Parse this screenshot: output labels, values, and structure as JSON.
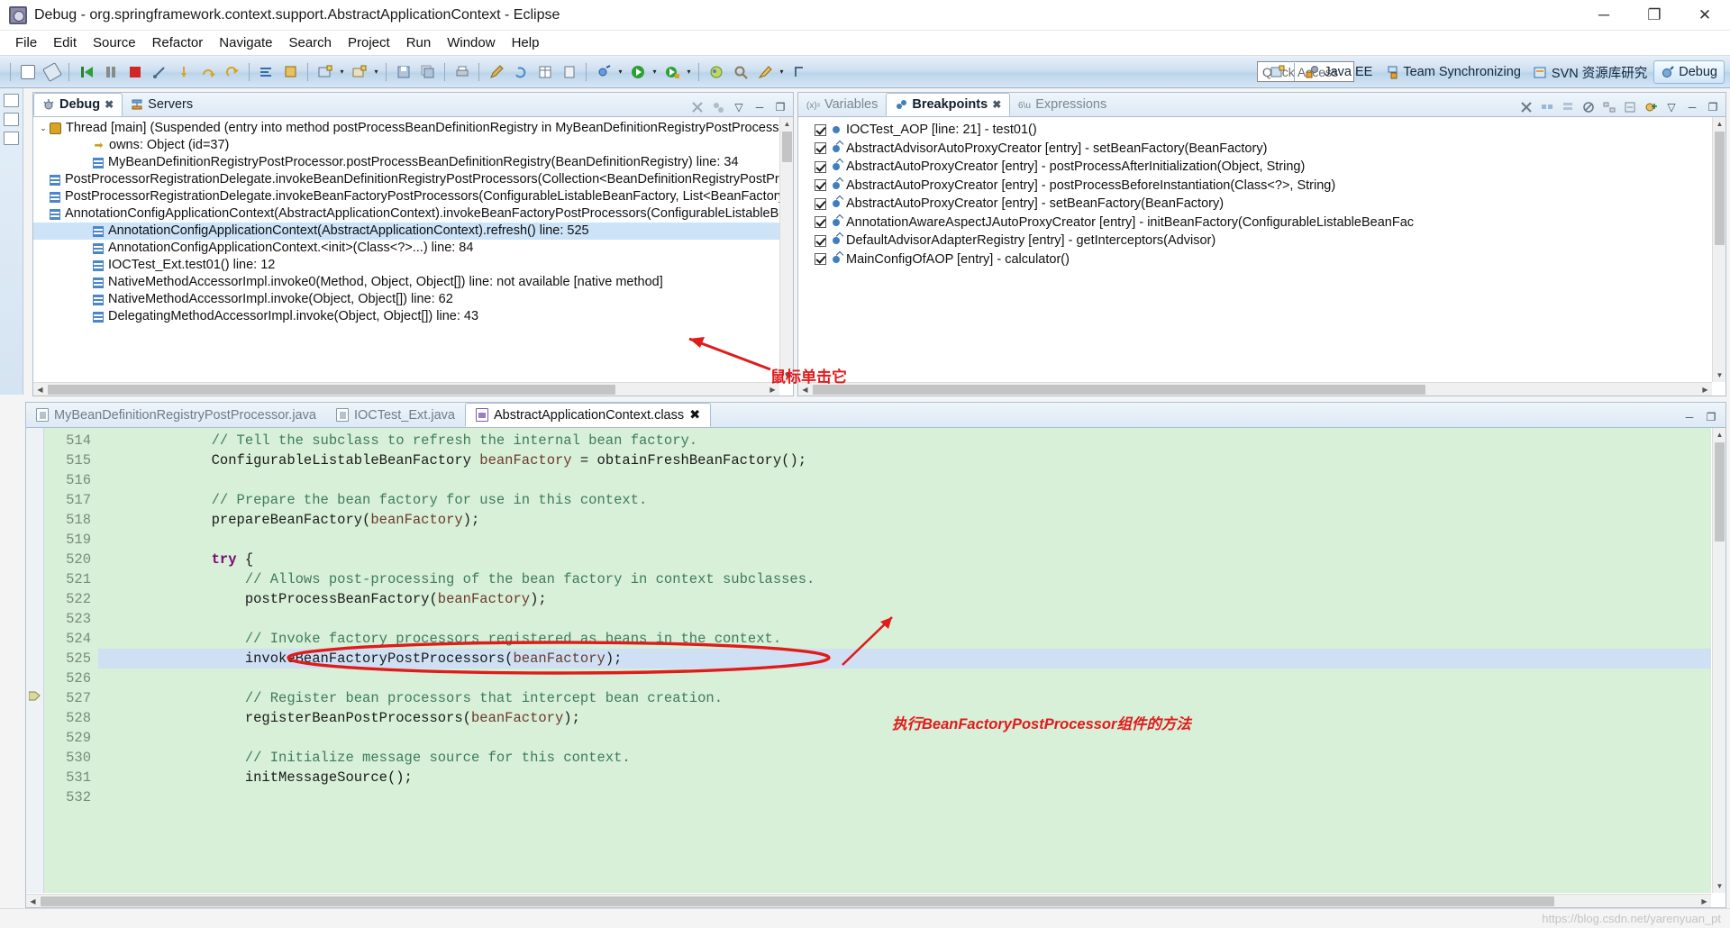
{
  "window": {
    "title": "Debug - org.springframework.context.support.AbstractApplicationContext - Eclipse",
    "app_icon": "eclipse-icon",
    "minimize": "─",
    "maximize": "❐",
    "close": "✕"
  },
  "menubar": [
    "File",
    "Edit",
    "Source",
    "Refactor",
    "Navigate",
    "Search",
    "Project",
    "Run",
    "Window",
    "Help"
  ],
  "toolbar": {
    "quick_access_placeholder": "Quick Access",
    "perspectives": [
      {
        "label": "Java EE",
        "icon": "java-ee-perspective-icon",
        "active": false
      },
      {
        "label": "Team Synchronizing",
        "icon": "team-sync-perspective-icon",
        "active": false
      },
      {
        "label": "SVN 资源库研究",
        "icon": "svn-perspective-icon",
        "active": false
      },
      {
        "label": "Debug",
        "icon": "debug-perspective-icon",
        "active": true
      }
    ]
  },
  "debug_view": {
    "tabs": [
      {
        "label": "Debug",
        "icon": "debug-icon",
        "active": true,
        "close": "✖"
      },
      {
        "label": "Servers",
        "icon": "servers-icon",
        "active": false
      }
    ],
    "tree": [
      {
        "indent": 0,
        "arrow": "⌄",
        "icon": "thread-icon",
        "text": "Thread [main] (Suspended (entry into method postProcessBeanDefinitionRegistry in MyBeanDefinitionRegistryPostProcessor))",
        "selected": false
      },
      {
        "indent": 1,
        "arrow": "",
        "icon": "owns-monitor-icon",
        "text": "owns: Object  (id=37)",
        "selected": false
      },
      {
        "indent": 1,
        "arrow": "",
        "icon": "stack-frame-icon",
        "text": "MyBeanDefinitionRegistryPostProcessor.postProcessBeanDefinitionRegistry(BeanDefinitionRegistry) line: 34",
        "selected": false
      },
      {
        "indent": 1,
        "arrow": "",
        "icon": "stack-frame-icon",
        "text": "PostProcessorRegistrationDelegate.invokeBeanDefinitionRegistryPostProcessors(Collection<BeanDefinitionRegistryPostProce",
        "selected": false
      },
      {
        "indent": 1,
        "arrow": "",
        "icon": "stack-frame-icon",
        "text": "PostProcessorRegistrationDelegate.invokeBeanFactoryPostProcessors(ConfigurableListableBeanFactory, List<BeanFactoryPos",
        "selected": false
      },
      {
        "indent": 1,
        "arrow": "",
        "icon": "stack-frame-icon",
        "text": "AnnotationConfigApplicationContext(AbstractApplicationContext).invokeBeanFactoryPostProcessors(ConfigurableListableBea",
        "selected": false
      },
      {
        "indent": 1,
        "arrow": "",
        "icon": "stack-frame-icon",
        "text": "AnnotationConfigApplicationContext(AbstractApplicationContext).refresh() line: 525",
        "selected": true
      },
      {
        "indent": 1,
        "arrow": "",
        "icon": "stack-frame-icon",
        "text": "AnnotationConfigApplicationContext.<init>(Class<?>...) line: 84",
        "selected": false
      },
      {
        "indent": 1,
        "arrow": "",
        "icon": "stack-frame-icon",
        "text": "IOCTest_Ext.test01() line: 12",
        "selected": false
      },
      {
        "indent": 1,
        "arrow": "",
        "icon": "stack-frame-icon",
        "text": "NativeMethodAccessorImpl.invoke0(Method, Object, Object[]) line: not available [native method]",
        "selected": false
      },
      {
        "indent": 1,
        "arrow": "",
        "icon": "stack-frame-icon",
        "text": "NativeMethodAccessorImpl.invoke(Object, Object[]) line: 62",
        "selected": false
      },
      {
        "indent": 1,
        "arrow": "",
        "icon": "stack-frame-icon",
        "text": "DelegatingMethodAccessorImpl.invoke(Object, Object[]) line: 43",
        "selected": false
      }
    ]
  },
  "breakpoints_view": {
    "tabs": [
      {
        "label": "Variables",
        "icon": "variables-icon",
        "active": false
      },
      {
        "label": "Breakpoints",
        "icon": "breakpoints-icon",
        "active": true,
        "close": "✖"
      },
      {
        "label": "Expressions",
        "icon": "expressions-icon",
        "active": false
      }
    ],
    "items": [
      {
        "checked": true,
        "type": "line",
        "text": "IOCTest_AOP [line: 21] - test01()"
      },
      {
        "checked": true,
        "type": "entry",
        "text": "AbstractAdvisorAutoProxyCreator [entry] - setBeanFactory(BeanFactory)"
      },
      {
        "checked": true,
        "type": "entry",
        "text": "AbstractAutoProxyCreator [entry] - postProcessAfterInitialization(Object, String)"
      },
      {
        "checked": true,
        "type": "entry",
        "text": "AbstractAutoProxyCreator [entry] - postProcessBeforeInstantiation(Class<?>, String)"
      },
      {
        "checked": true,
        "type": "entry",
        "text": "AbstractAutoProxyCreator [entry] - setBeanFactory(BeanFactory)"
      },
      {
        "checked": true,
        "type": "entry",
        "text": "AnnotationAwareAspectJAutoProxyCreator [entry] - initBeanFactory(ConfigurableListableBeanFac"
      },
      {
        "checked": true,
        "type": "entry",
        "text": "DefaultAdvisorAdapterRegistry [entry] - getInterceptors(Advisor)"
      },
      {
        "checked": true,
        "type": "entry",
        "text": "MainConfigOfAOP [entry] - calculator()"
      }
    ]
  },
  "editor": {
    "tabs": [
      {
        "label": "MyBeanDefinitionRegistryPostProcessor.java",
        "icon": "java-file-icon",
        "active": false
      },
      {
        "label": "IOCTest_Ext.java",
        "icon": "java-file-icon",
        "active": false
      },
      {
        "label": "AbstractApplicationContext.class",
        "icon": "class-file-icon",
        "active": true,
        "close": "✖"
      }
    ],
    "lines": [
      {
        "num": "514",
        "indent": 3,
        "kind": "comment",
        "text": "// Tell the subclass to refresh the internal bean factory."
      },
      {
        "num": "515",
        "indent": 3,
        "kind": "code",
        "text": "ConfigurableListableBeanFactory beanFactory = obtainFreshBeanFactory();"
      },
      {
        "num": "516",
        "indent": 0,
        "kind": "code",
        "text": ""
      },
      {
        "num": "517",
        "indent": 3,
        "kind": "comment",
        "text": "// Prepare the bean factory for use in this context."
      },
      {
        "num": "518",
        "indent": 3,
        "kind": "code",
        "text": "prepareBeanFactory(beanFactory);"
      },
      {
        "num": "519",
        "indent": 0,
        "kind": "code",
        "text": ""
      },
      {
        "num": "520",
        "indent": 3,
        "kind": "code",
        "text": "try {"
      },
      {
        "num": "521",
        "indent": 4,
        "kind": "comment",
        "text": "// Allows post-processing of the bean factory in context subclasses."
      },
      {
        "num": "522",
        "indent": 4,
        "kind": "code",
        "text": "postProcessBeanFactory(beanFactory);"
      },
      {
        "num": "523",
        "indent": 0,
        "kind": "code",
        "text": ""
      },
      {
        "num": "524",
        "indent": 4,
        "kind": "comment",
        "text": "// Invoke factory processors registered as beans in the context."
      },
      {
        "num": "525",
        "indent": 4,
        "kind": "code",
        "text": "invokeBeanFactoryPostProcessors(beanFactory);",
        "highlight": true
      },
      {
        "num": "526",
        "indent": 0,
        "kind": "code",
        "text": ""
      },
      {
        "num": "527",
        "indent": 4,
        "kind": "comment",
        "text": "// Register bean processors that intercept bean creation."
      },
      {
        "num": "528",
        "indent": 4,
        "kind": "code",
        "text": "registerBeanPostProcessors(beanFactory);"
      },
      {
        "num": "529",
        "indent": 0,
        "kind": "code",
        "text": ""
      },
      {
        "num": "530",
        "indent": 4,
        "kind": "comment",
        "text": "// Initialize message source for this context."
      },
      {
        "num": "531",
        "indent": 4,
        "kind": "code",
        "text": "initMessageSource();"
      },
      {
        "num": "532",
        "indent": 0,
        "kind": "code",
        "text": ""
      }
    ]
  },
  "annotations": {
    "arrow_note_1": "鼠标单击它",
    "arrow_note_2": "执行BeanFactoryPostProcessor组件的方法",
    "color": "#e01b1b"
  },
  "statusbar": {
    "watermark": "https://blog.csdn.net/yarenyuan_pt"
  }
}
